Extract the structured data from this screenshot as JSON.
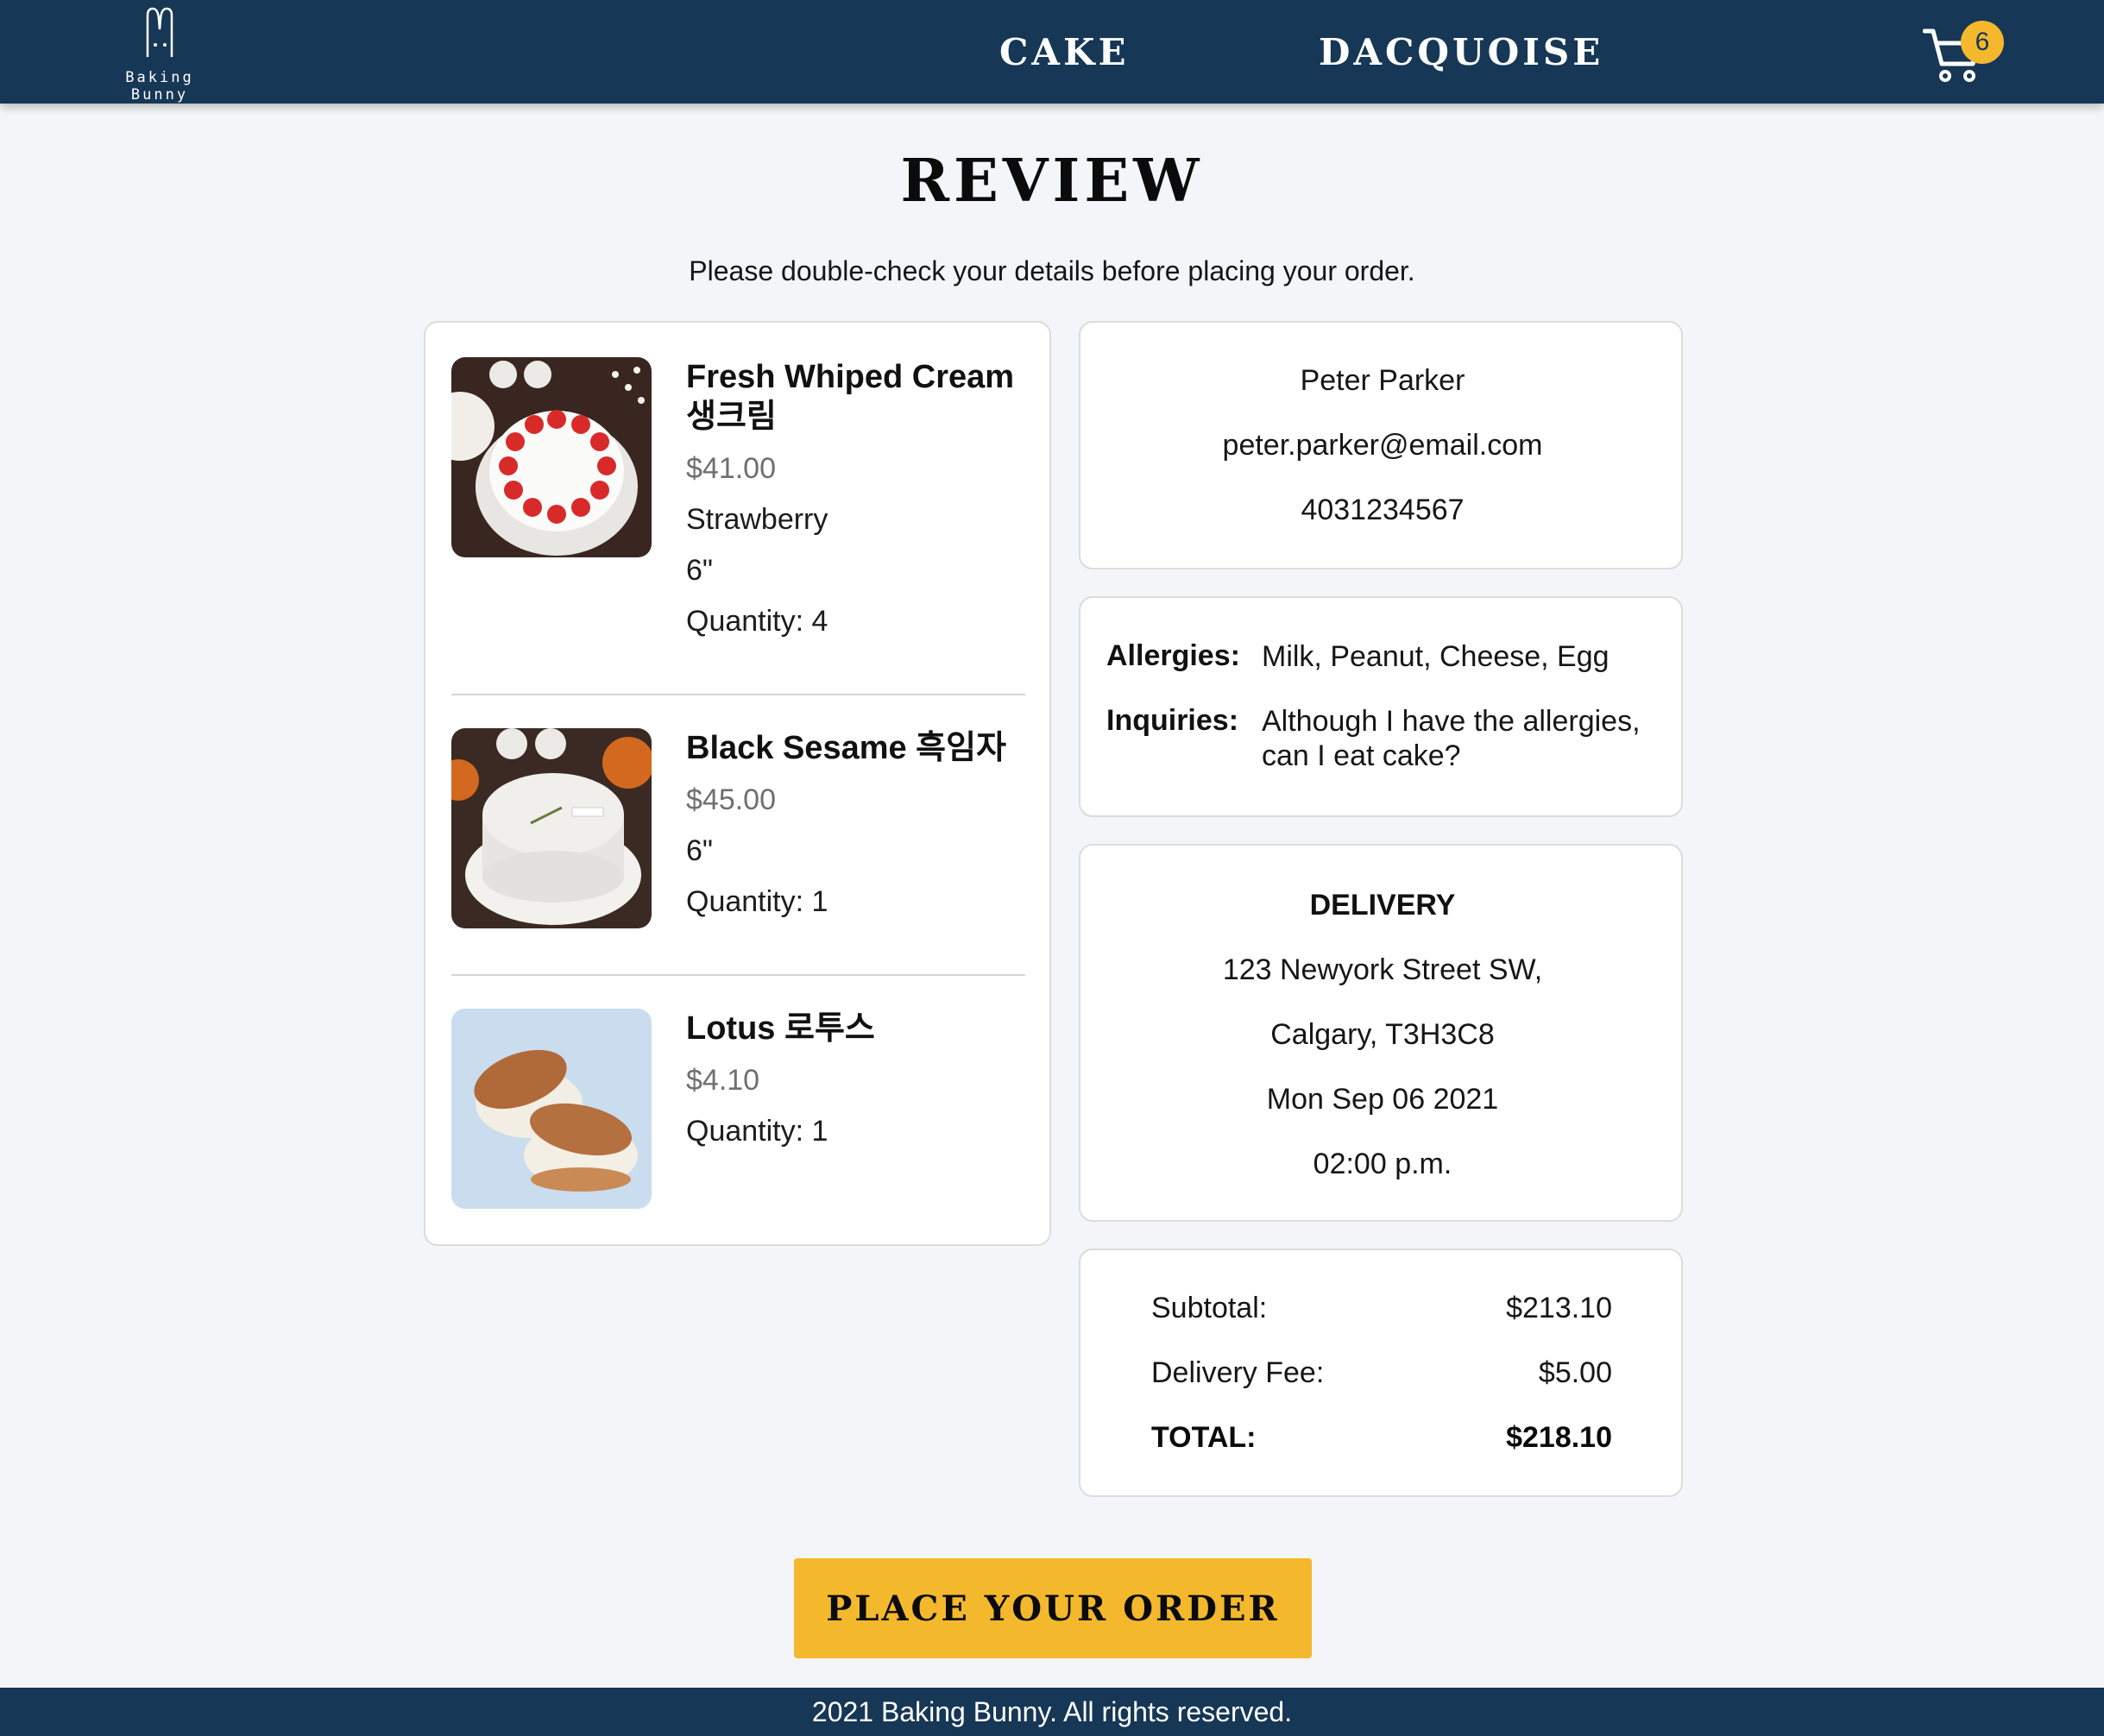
{
  "header": {
    "logo_text": "Baking Bunny",
    "nav": [
      {
        "label": "CAKE"
      },
      {
        "label": "DACQUOISE"
      }
    ],
    "cart_count": "6"
  },
  "page": {
    "title": "REVIEW",
    "subtitle": "Please double-check your details before placing your order."
  },
  "items": [
    {
      "name": "Fresh Whiped Cream 생크림",
      "price": "$41.00",
      "flavor": "Strawberry",
      "size": "6\"",
      "quantity": "Quantity: 4"
    },
    {
      "name": "Black Sesame 흑임자",
      "price": "$45.00",
      "size": "6\"",
      "quantity": "Quantity: 1"
    },
    {
      "name": "Lotus 로투스",
      "price": "$4.10",
      "quantity": "Quantity: 1"
    }
  ],
  "contact": {
    "name": "Peter Parker",
    "email": "peter.parker@email.com",
    "phone": "4031234567"
  },
  "notes": {
    "allergies_label": "Allergies:",
    "allergies_value": "Milk, Peanut, Cheese, Egg",
    "inquiries_label": "Inquiries:",
    "inquiries_value": "Although I have the allergies, can I eat cake?"
  },
  "delivery": {
    "title": "DELIVERY",
    "street": "123 Newyork Street SW,",
    "city": "Calgary, T3H3C8",
    "date": "Mon Sep 06 2021",
    "time": "02:00 p.m."
  },
  "totals": {
    "subtotal_label": "Subtotal:",
    "subtotal_value": "$213.10",
    "fee_label": "Delivery Fee:",
    "fee_value": "$5.00",
    "total_label": "TOTAL:",
    "total_value": "$218.10"
  },
  "actions": {
    "place_order_label": "PLACE YOUR ORDER"
  },
  "footer": {
    "text": "2021 Baking Bunny. All rights reserved."
  },
  "colors": {
    "navy": "#163755",
    "accent": "#f4b82c",
    "background": "#f4f5f8"
  }
}
